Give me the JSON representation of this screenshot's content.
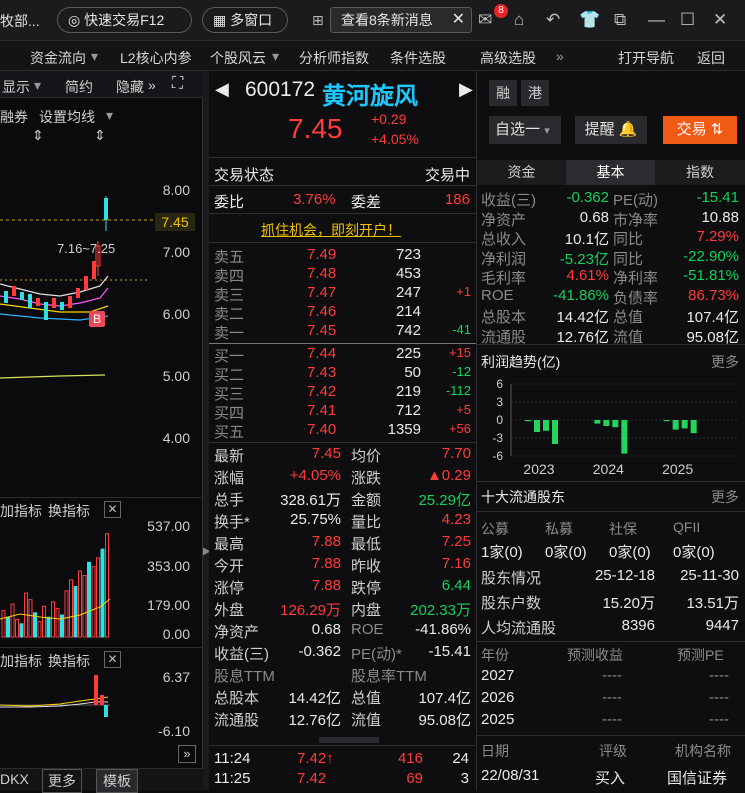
{
  "topbar": {
    "left_cut": "牧部...",
    "quick_trade": "快速交易F12",
    "multi_window": "多窗口",
    "news": "查看8条新消息",
    "mail_badge": "8"
  },
  "menubar": [
    "资金流向",
    "L2核心内参",
    "个股风云",
    "分析师指数",
    "条件选股",
    "高级选股",
    "打开导航",
    "返回"
  ],
  "left": {
    "toolbar": [
      "显示",
      "简约",
      "隐藏"
    ],
    "toolbar2": [
      "融券",
      "设置均线"
    ],
    "yticks": [
      "8.00",
      "7.00",
      "6.00",
      "5.00",
      "4.00"
    ],
    "price_tag": "7.45",
    "range_label": "7.16~7.25",
    "b_marker": "B",
    "ind1_labels": [
      "加指标",
      "换指标"
    ],
    "ind1_ticks": [
      "537.00",
      "353.00",
      "179.00",
      "0.00"
    ],
    "ind2_labels": [
      "加指标",
      "换指标"
    ],
    "ind2_ticks": [
      "6.37",
      "-6.10"
    ],
    "bottom": [
      "DKX",
      "更多",
      "模板"
    ],
    "volume": [
      120,
      90,
      150,
      80,
      60,
      200,
      170,
      110,
      70,
      140,
      90,
      160,
      130,
      100,
      210,
      260,
      230,
      300,
      280,
      340,
      320,
      360,
      400,
      470
    ]
  },
  "quote": {
    "code": "600172",
    "name": "黄河旋风",
    "tag_margin": "融",
    "tag_hk": "港",
    "price": "7.45",
    "change": "+0.29",
    "change_pct": "+4.05%",
    "watch": "自选一",
    "remind": "提醒",
    "trade": "交易",
    "status_label": "交易状态",
    "status": "交易中",
    "weibi_label": "委比",
    "weibi": "3.76%",
    "weicha_label": "委差",
    "weicha": "186",
    "promo": "抓住机会，即刻开户！"
  },
  "asks": [
    {
      "label": "卖五",
      "price": "7.49",
      "vol": "723",
      "chg": ""
    },
    {
      "label": "卖四",
      "price": "7.48",
      "vol": "453",
      "chg": ""
    },
    {
      "label": "卖三",
      "price": "7.47",
      "vol": "247",
      "chg": "+1"
    },
    {
      "label": "卖二",
      "price": "7.46",
      "vol": "214",
      "chg": ""
    },
    {
      "label": "卖一",
      "price": "7.45",
      "vol": "742",
      "chg": "-41"
    }
  ],
  "bids": [
    {
      "label": "买一",
      "price": "7.44",
      "vol": "225",
      "chg": "+15"
    },
    {
      "label": "买二",
      "price": "7.43",
      "vol": "50",
      "chg": "-12"
    },
    {
      "label": "买三",
      "price": "7.42",
      "vol": "219",
      "chg": "-112"
    },
    {
      "label": "买四",
      "price": "7.41",
      "vol": "712",
      "chg": "+5"
    },
    {
      "label": "买五",
      "price": "7.40",
      "vol": "1359",
      "chg": "+56"
    }
  ],
  "stats": [
    [
      "最新",
      "7.45",
      "均价",
      "7.70"
    ],
    [
      "涨幅",
      "+4.05%",
      "涨跌",
      "▲0.29"
    ],
    [
      "总手",
      "328.61万",
      "金额",
      "25.29亿"
    ],
    [
      "换手*",
      "25.75%",
      "量比",
      "4.23"
    ],
    [
      "最高",
      "7.88",
      "最低",
      "7.25"
    ],
    [
      "今开",
      "7.88",
      "昨收",
      "7.16"
    ],
    [
      "涨停",
      "7.88",
      "跌停",
      "6.44"
    ],
    [
      "外盘",
      "126.29万",
      "内盘",
      "202.33万"
    ],
    [
      "净资产",
      "0.68",
      "ROE",
      "-41.86%"
    ],
    [
      "收益(三)",
      "-0.362",
      "PE(动)*",
      "-15.41"
    ],
    [
      "股息TTM",
      "",
      "股息率TTM",
      ""
    ],
    [
      "总股本",
      "14.42亿",
      "总值",
      "107.4亿"
    ],
    [
      "流通股",
      "12.76亿",
      "流值",
      "95.08亿"
    ]
  ],
  "ticks": [
    {
      "time": "11:24",
      "price": "7.42↑",
      "vol": "416",
      "n": "24"
    },
    {
      "time": "11:25",
      "price": "7.42",
      "vol": "69",
      "n": "3"
    }
  ],
  "tabs": [
    "资金",
    "基本",
    "指数"
  ],
  "fundamentals": [
    [
      "收益(三)",
      "-0.362",
      "PE(动)",
      "-15.41"
    ],
    [
      "净资产",
      "0.68",
      "市净率",
      "10.88"
    ],
    [
      "总收入",
      "10.1亿",
      "同比",
      "7.29%"
    ],
    [
      "净利润",
      "-5.23亿",
      "同比",
      "-22.90%"
    ],
    [
      "毛利率",
      "4.61%",
      "净利率",
      "-51.81%"
    ],
    [
      "ROE",
      "-41.86%",
      "负债率",
      "86.73%"
    ],
    [
      "总股本",
      "14.42亿",
      "总值",
      "107.4亿"
    ],
    [
      "流通股",
      "12.76亿",
      "流值",
      "95.08亿"
    ]
  ],
  "profit": {
    "title": "利润趋势(亿)",
    "more": "更多",
    "yticks": [
      "6",
      "3",
      "0",
      "-3",
      "-6"
    ],
    "years": [
      "2023",
      "2024",
      "2025"
    ]
  },
  "chart_data": {
    "type": "bar",
    "ylim": [
      -6,
      6
    ],
    "values": [
      -0.2,
      -2.0,
      -1.8,
      -4.0,
      -0.6,
      -1.0,
      -1.2,
      -5.6,
      -0.2,
      -1.6,
      -1.4,
      -2.2
    ],
    "x_labels": [
      "2023",
      "2024",
      "2025"
    ]
  },
  "holders": {
    "title": "十大流通股东",
    "more": "更多",
    "heads": [
      "公募",
      "私募",
      "社保",
      "QFII"
    ],
    "counts": [
      "1家(0)",
      "0家(0)",
      "0家(0)",
      "0家(0)"
    ],
    "rows": [
      [
        "股东情况",
        "25-12-18",
        "25-11-30"
      ],
      [
        "股东户数",
        "15.20万",
        "13.51万"
      ],
      [
        "人均流通股",
        "8396",
        "9447"
      ]
    ]
  },
  "forecast": {
    "heads": [
      "年份",
      "预测收益",
      "预测PE"
    ],
    "rows": [
      [
        "2027",
        "----",
        "----"
      ],
      [
        "2026",
        "----",
        "----"
      ],
      [
        "2025",
        "----",
        "----"
      ]
    ]
  },
  "rating": {
    "heads": [
      "日期",
      "评级",
      "机构名称"
    ],
    "row": [
      "22/08/31",
      "买入",
      "国信证券"
    ]
  }
}
